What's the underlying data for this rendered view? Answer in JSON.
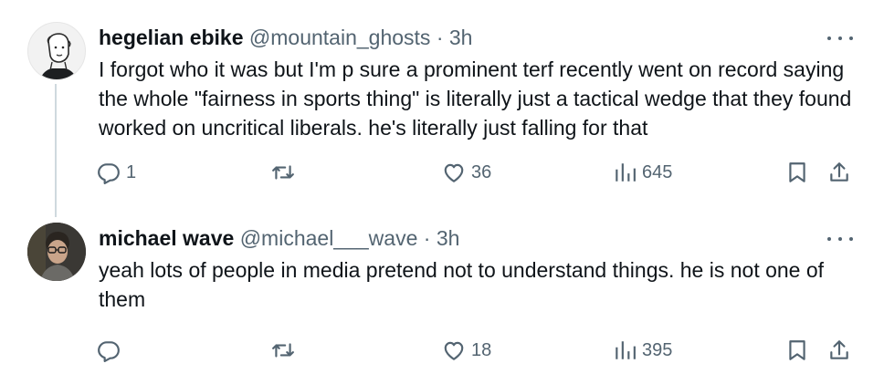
{
  "tweets": [
    {
      "name": "hegelian ebike",
      "handle": "@mountain_ghosts",
      "separator": "·",
      "time": "3h",
      "text": "I forgot who it was but I'm p sure a prominent terf recently went on record saying the whole \"fairness in sports thing\" is literally just a tactical wedge that they found worked on uncritical liberals. he's literally just falling for that",
      "replies": "1",
      "likes": "36",
      "views": "645"
    },
    {
      "name": "michael wave",
      "handle": "@michael___wave",
      "separator": "·",
      "time": "3h",
      "text": "yeah lots of people in media pretend not to understand things. he is not one of them",
      "replies": "",
      "likes": "18",
      "views": "395"
    }
  ],
  "colors": {
    "text": "#0f1419",
    "secondary": "#536471",
    "thread_line": "#cfd9de"
  },
  "icons": [
    "reply-icon",
    "retweet-icon",
    "like-icon",
    "views-icon",
    "bookmark-icon",
    "share-icon",
    "more-icon"
  ]
}
